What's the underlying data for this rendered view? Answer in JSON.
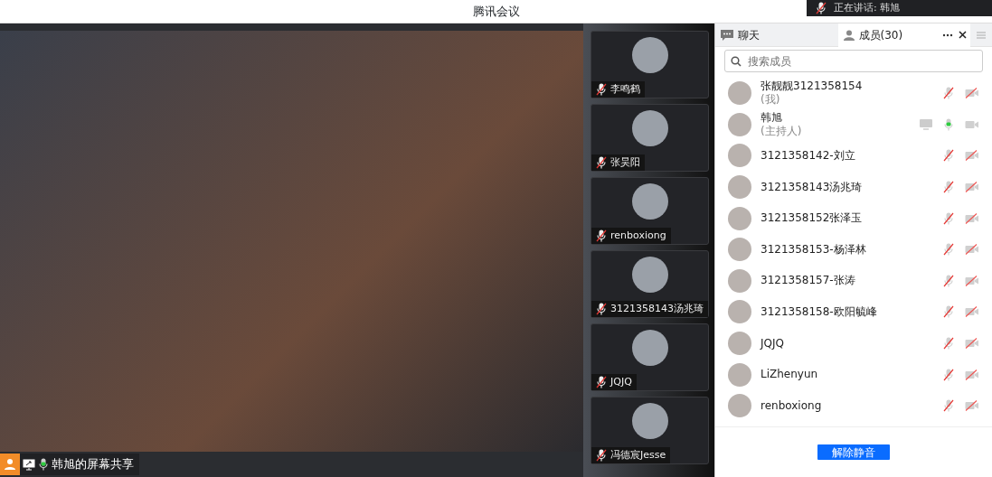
{
  "window": {
    "title": "腾讯会议"
  },
  "speaking_toast": {
    "text": "正在讲话: 韩旭"
  },
  "share": {
    "label": "韩旭的屏幕共享",
    "mic_on": true
  },
  "video_tiles": [
    {
      "name": "李鸣鹤",
      "mic_on": false
    },
    {
      "name": "张昊阳",
      "mic_on": false
    },
    {
      "name": "renboxiong",
      "mic_on": false
    },
    {
      "name": "3121358143汤兆琦",
      "mic_on": false
    },
    {
      "name": "JQJQ",
      "mic_on": false
    },
    {
      "name": "冯德宸Jesse",
      "mic_on": false
    }
  ],
  "tabs": [
    {
      "label": "聊天",
      "kind": "chat",
      "selected": false
    },
    {
      "label": "成员(30)",
      "kind": "members",
      "selected": true
    }
  ],
  "search": {
    "placeholder": "搜索成员"
  },
  "members": [
    {
      "name": "张靓靓3121358154",
      "role": "(我)",
      "sharing": false,
      "mic_on": false,
      "camera_on": false
    },
    {
      "name": "韩旭",
      "role": "(主持人)",
      "sharing": true,
      "mic_on": true,
      "camera_on": true
    },
    {
      "name": "3121358142-刘立",
      "sharing": false,
      "mic_on": false,
      "camera_on": false
    },
    {
      "name": "3121358143汤兆琦",
      "sharing": false,
      "mic_on": false,
      "camera_on": false
    },
    {
      "name": "3121358152张泽玉",
      "sharing": false,
      "mic_on": false,
      "camera_on": false
    },
    {
      "name": "3121358153-杨泽林",
      "sharing": false,
      "mic_on": false,
      "camera_on": false
    },
    {
      "name": "3121358157-张涛",
      "sharing": false,
      "mic_on": false,
      "camera_on": false
    },
    {
      "name": "3121358158-欧阳毓峰",
      "sharing": false,
      "mic_on": false,
      "camera_on": false
    },
    {
      "name": "JQJQ",
      "sharing": false,
      "mic_on": false,
      "camera_on": false
    },
    {
      "name": "LiZhenyun",
      "sharing": false,
      "mic_on": false,
      "camera_on": false
    },
    {
      "name": "renboxiong",
      "sharing": false,
      "mic_on": false,
      "camera_on": false
    }
  ],
  "unmute_button": {
    "label": "解除静音"
  }
}
